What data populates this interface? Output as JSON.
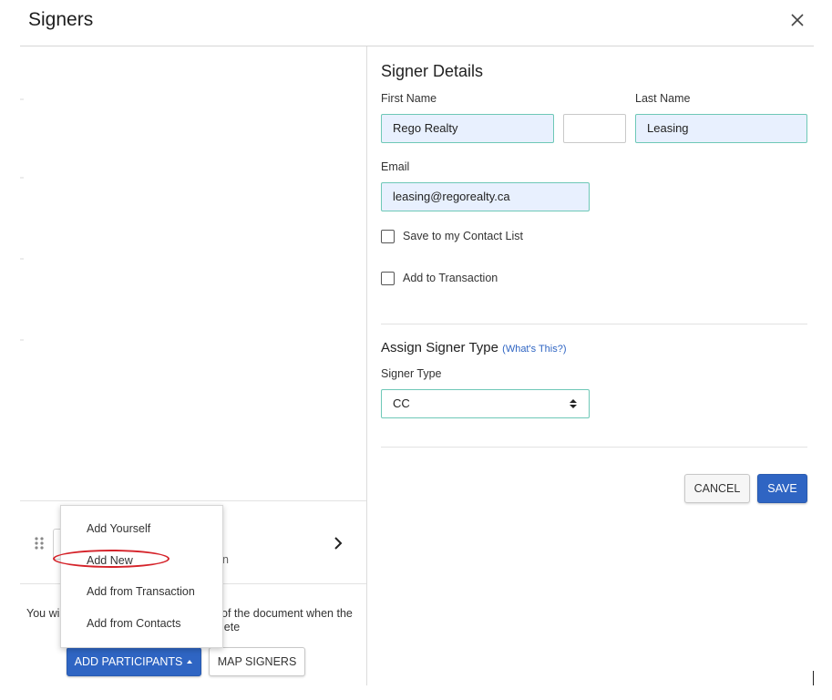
{
  "dialog": {
    "title": "Signers",
    "close_icon": "close-icon"
  },
  "signer_details": {
    "heading": "Signer Details",
    "first_name_label": "First Name",
    "last_name_label": "Last Name",
    "first_name_value": "Rego Realty",
    "middle_value": "",
    "last_name_value": "Leasing",
    "email_label": "Email",
    "email_value": "leasing@regorealty.ca",
    "save_contact_label": "Save to my Contact List",
    "save_contact_checked": false,
    "add_transaction_label": "Add to Transaction",
    "add_transaction_checked": false
  },
  "signer_type": {
    "heading": "Assign Signer Type",
    "help_link": "What's This?",
    "type_label": "Signer Type",
    "selected": "CC"
  },
  "actions": {
    "cancel": "CANCEL",
    "save": "SAVE"
  },
  "left_panel": {
    "row_partial_text": "n",
    "info_left": "You wi",
    "info_right_line1": "of the document when the",
    "info_right_line2": "lete"
  },
  "participants_menu": {
    "items": [
      "Add Yourself",
      "Add New",
      "Add from Transaction",
      "Add from Contacts"
    ],
    "highlighted": "Add New"
  },
  "footer": {
    "add_participants": "ADD PARTICIPANTS",
    "map_signers": "MAP SIGNERS"
  },
  "colors": {
    "primary": "#2f65c3",
    "field_border": "#6ec8b7",
    "field_fill": "#e8f0fe",
    "highlight_circle": "#d5232a",
    "link": "#2f65c3"
  }
}
